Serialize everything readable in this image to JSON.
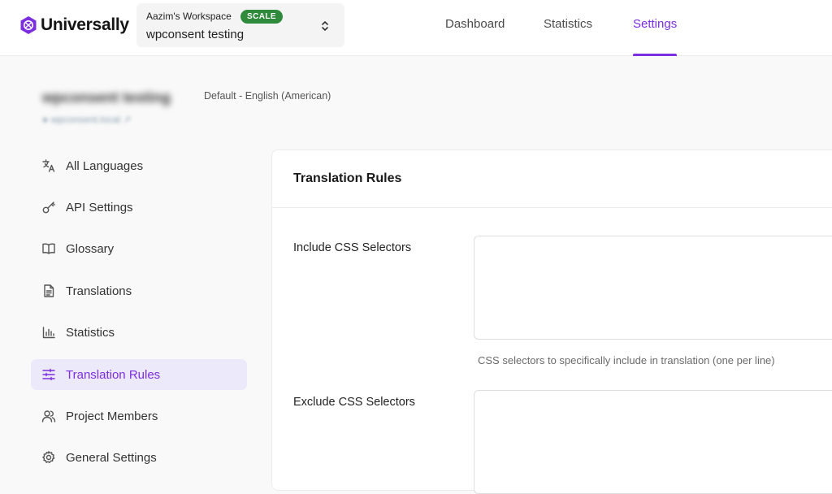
{
  "brand": {
    "name": "Universally",
    "color": "#7b2fe0"
  },
  "workspace": {
    "name": "Aazim's Workspace",
    "plan_badge": "SCALE",
    "project": "wpconsent testing"
  },
  "nav": {
    "tabs": [
      {
        "label": "Dashboard",
        "active": false
      },
      {
        "label": "Statistics",
        "active": false
      },
      {
        "label": "Settings",
        "active": true
      }
    ]
  },
  "project": {
    "name": "wpconsent testing",
    "language": "Default - English (American)",
    "url": "wpconsent.local"
  },
  "sidebar": {
    "items": [
      {
        "label": "All Languages",
        "icon": "translate-icon",
        "active": false
      },
      {
        "label": "API Settings",
        "icon": "key-icon",
        "active": false
      },
      {
        "label": "Glossary",
        "icon": "book-icon",
        "active": false
      },
      {
        "label": "Translations",
        "icon": "document-icon",
        "active": false
      },
      {
        "label": "Statistics",
        "icon": "bar-chart-icon",
        "active": false
      },
      {
        "label": "Translation Rules",
        "icon": "sliders-icon",
        "active": true
      },
      {
        "label": "Project Members",
        "icon": "users-icon",
        "active": false
      },
      {
        "label": "General Settings",
        "icon": "gear-icon",
        "active": false
      }
    ]
  },
  "panel": {
    "title": "Translation Rules",
    "include": {
      "label": "Include CSS Selectors",
      "value": "",
      "help": "CSS selectors to specifically include in translation (one per line)"
    },
    "exclude": {
      "label": "Exclude CSS Selectors",
      "value": ""
    }
  }
}
